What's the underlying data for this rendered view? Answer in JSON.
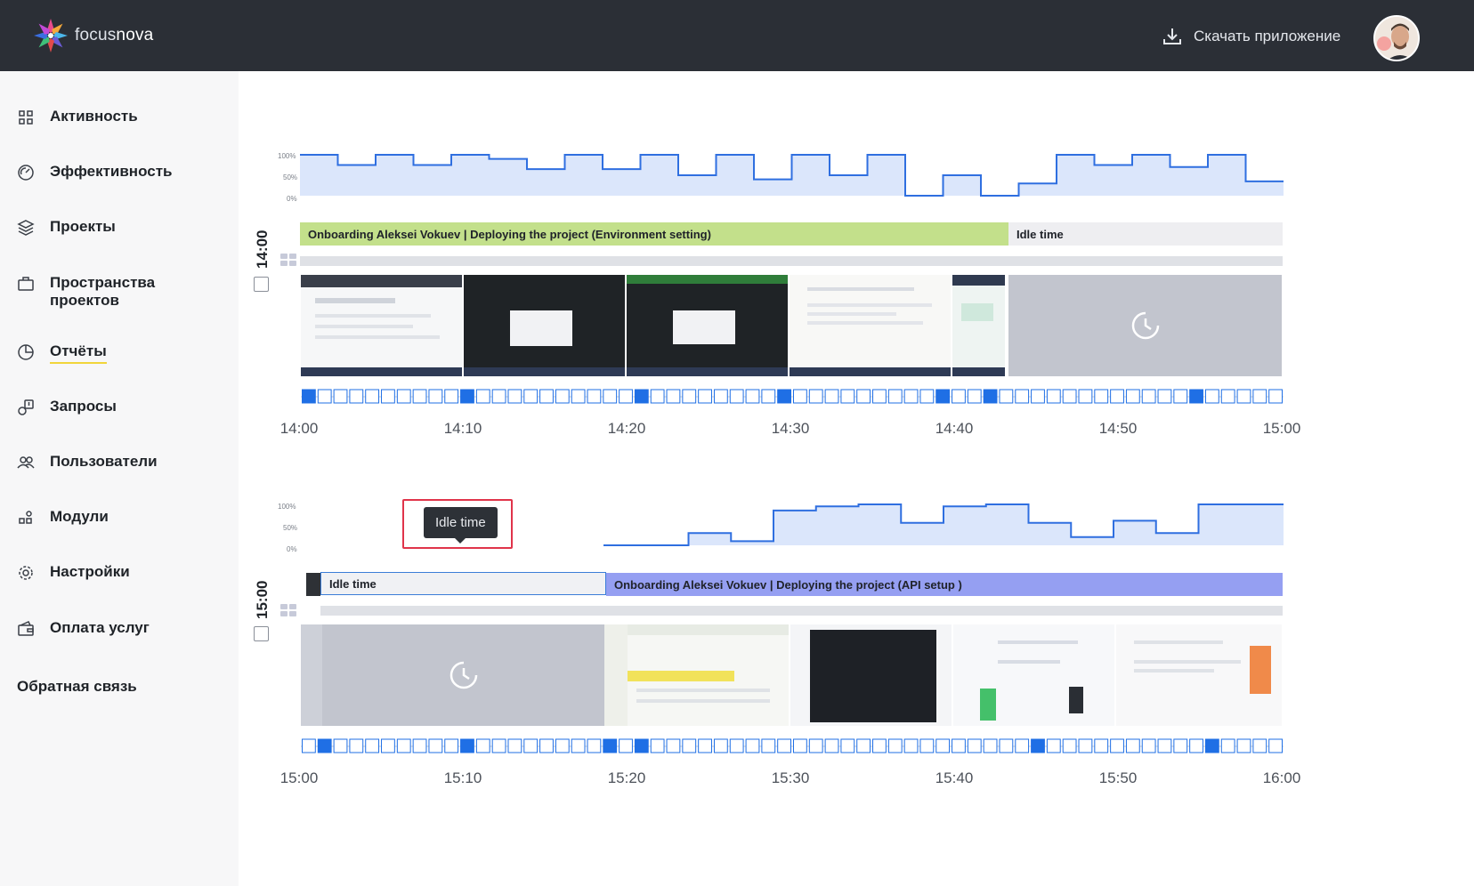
{
  "app": {
    "brand_prefix": "focus",
    "brand_suffix": "nova",
    "download_label": "Скачать приложение"
  },
  "sidebar": {
    "items": [
      {
        "label": "Активность",
        "icon": "grid-icon"
      },
      {
        "label": "Эффективность",
        "icon": "gauge-icon"
      },
      {
        "label": "Проекты",
        "icon": "layers-icon"
      },
      {
        "label": "Пространства проектов",
        "icon": "briefcase-icon"
      },
      {
        "label": "Отчёты",
        "icon": "pie-chart-icon",
        "active": true
      },
      {
        "label": "Запросы",
        "icon": "request-icon"
      },
      {
        "label": "Пользователи",
        "icon": "users-icon"
      },
      {
        "label": "Модули",
        "icon": "modules-icon"
      },
      {
        "label": "Настройки",
        "icon": "gear-icon"
      },
      {
        "label": "Оплата услуг",
        "icon": "wallet-icon"
      }
    ],
    "feedback_label": "Обратная связь"
  },
  "activity_axis": [
    "100%",
    "50%",
    "0%"
  ],
  "blocks": [
    {
      "hour": "14:00",
      "activity_levels": [
        1.0,
        0.75,
        1.0,
        0.75,
        1.0,
        0.9,
        0.65,
        1.0,
        0.65,
        1.0,
        0.5,
        1.0,
        0.4,
        1.0,
        0.5,
        1.0,
        0.0,
        0.5,
        0.0,
        0.3,
        1.0,
        0.75,
        1.0,
        0.7,
        1.0,
        0.35
      ],
      "tasks": [
        {
          "label": "Onboarding Aleksei Vokuev | Deploying the project (Environment setting)",
          "kind": "green"
        },
        {
          "label": "Idle time",
          "kind": "idle"
        }
      ],
      "thumbs": [
        "screen",
        "screen",
        "screen",
        "screen",
        "screen",
        "idle"
      ],
      "time_labels": [
        "14:00",
        "14:10",
        "14:20",
        "14:30",
        "14:40",
        "14:50",
        "15:00"
      ]
    },
    {
      "hour": "15:00",
      "activity_levels": [
        0.0,
        0.0,
        0.3,
        0.1,
        0.85,
        0.95,
        1.0,
        0.55,
        0.95,
        1.0,
        0.55,
        0.2,
        0.6,
        0.3,
        1.0,
        1.0
      ],
      "tasks": [
        {
          "label": "Idle time",
          "kind": "idle-selected"
        },
        {
          "label": "Onboarding Aleksei Vokuev | Deploying the project (API setup )",
          "kind": "purple"
        }
      ],
      "thumbs": [
        "idle",
        "screen",
        "screen",
        "screen",
        "screen",
        "screen",
        "screen"
      ],
      "time_labels": [
        "15:00",
        "15:10",
        "15:20",
        "15:30",
        "15:40",
        "15:50",
        "16:00"
      ]
    }
  ],
  "tooltip": {
    "text": "Idle time"
  },
  "colors": {
    "topbar": "#2b2f36",
    "activity_line": "#2f6fe0",
    "activity_fill": "#dbe6fb",
    "green_task": "#c3e08b",
    "purple_task": "#959ff2",
    "idle_task": "#eeeef1",
    "highlight_frame": "#e0344a"
  }
}
